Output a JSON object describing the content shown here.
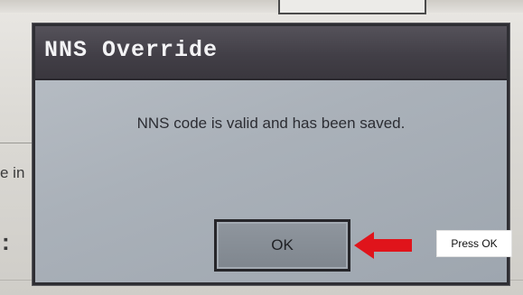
{
  "background": {
    "partial_text": "e in",
    "partial_symbol": ":"
  },
  "dialog": {
    "title": "NNS Override",
    "message": "NNS code is valid and has been saved.",
    "ok_label": "OK"
  },
  "annotation": {
    "callout_text": "Press OK",
    "arrow_color": "#e0141b"
  }
}
